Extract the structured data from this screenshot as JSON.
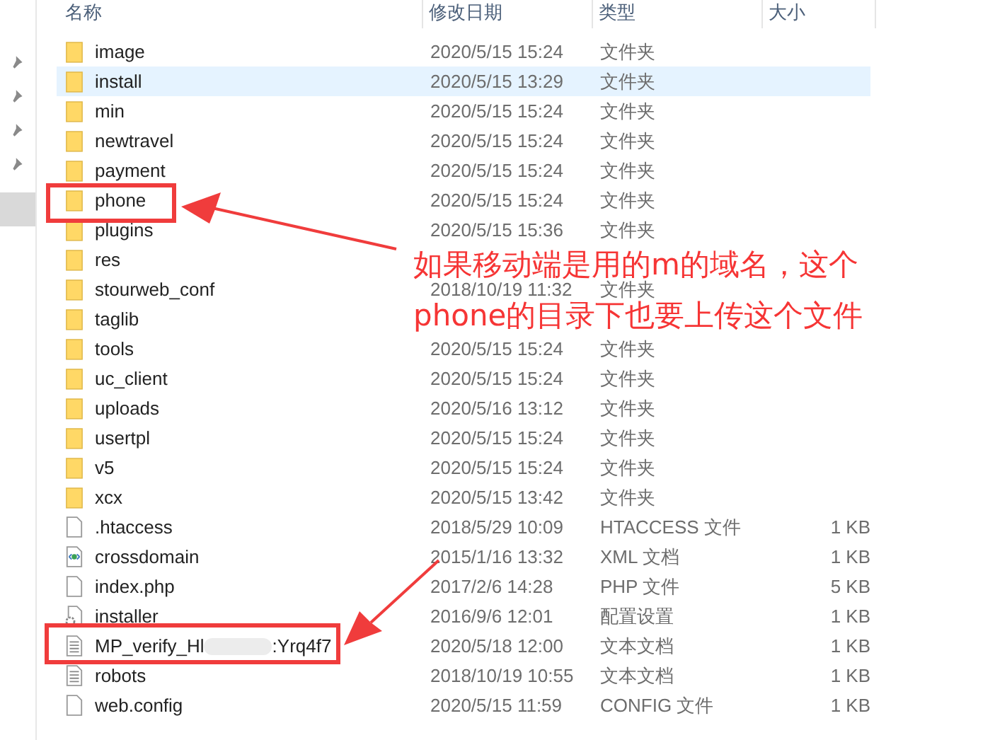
{
  "columns": [
    "名称",
    "修改日期",
    "类型",
    "大小"
  ],
  "rows": [
    {
      "kind": "folder",
      "name": "image",
      "date": "2020/5/15 15:24",
      "type": "文件夹",
      "hovered": false
    },
    {
      "kind": "folder",
      "name": "install",
      "date": "2020/5/15 13:29",
      "type": "文件夹",
      "hovered": true
    },
    {
      "kind": "folder",
      "name": "min",
      "date": "2020/5/15 15:24",
      "type": "文件夹",
      "hovered": false
    },
    {
      "kind": "folder",
      "name": "newtravel",
      "date": "2020/5/15 15:24",
      "type": "文件夹",
      "hovered": false
    },
    {
      "kind": "folder",
      "name": "payment",
      "date": "2020/5/15 15:24",
      "type": "文件夹",
      "hovered": false
    },
    {
      "kind": "folder",
      "name": "phone",
      "date": "2020/5/15 15:24",
      "type": "文件夹",
      "hovered": false
    },
    {
      "kind": "folder",
      "name": "plugins",
      "date": "2020/5/15 15:36",
      "type": "文件夹",
      "hovered": false
    },
    {
      "kind": "folder",
      "name": "res",
      "hovered": false
    },
    {
      "kind": "folder",
      "name": "stourweb_conf",
      "date": "2018/10/19 11:32",
      "type": "文件夹",
      "hovered": false
    },
    {
      "kind": "folder",
      "name": "taglib",
      "hovered": false
    },
    {
      "kind": "folder",
      "name": "tools",
      "date": "2020/5/15 15:24",
      "type": "文件夹",
      "hovered": false
    },
    {
      "kind": "folder",
      "name": "uc_client",
      "date": "2020/5/15 15:24",
      "type": "文件夹",
      "hovered": false
    },
    {
      "kind": "folder",
      "name": "uploads",
      "date": "2020/5/16 13:12",
      "type": "文件夹",
      "hovered": false
    },
    {
      "kind": "folder",
      "name": "usertpl",
      "date": "2020/5/15 15:24",
      "type": "文件夹",
      "hovered": false
    },
    {
      "kind": "folder",
      "name": "v5",
      "date": "2020/5/15 15:24",
      "type": "文件夹",
      "hovered": false
    },
    {
      "kind": "folder",
      "name": "xcx",
      "date": "2020/5/15 13:42",
      "type": "文件夹",
      "hovered": false
    },
    {
      "kind": "file",
      "name": ".htaccess",
      "date": "2018/5/29 10:09",
      "type": "HTACCESS 文件",
      "size": "1 KB",
      "hovered": false
    },
    {
      "kind": "xml",
      "name": "crossdomain",
      "date": "2015/1/16 13:32",
      "type": "XML 文档",
      "size": "1 KB",
      "hovered": false
    },
    {
      "kind": "file",
      "name": "index.php",
      "date": "2017/2/6 14:28",
      "type": "PHP 文件",
      "size": "5 KB",
      "hovered": false
    },
    {
      "kind": "settings",
      "name": "installer",
      "date": "2016/9/6 12:01",
      "type": "配置设置",
      "size": "1 KB",
      "hovered": false
    },
    {
      "kind": "text",
      "name": "MP_verify_Hl",
      "name_tail": ":Yrq4f7",
      "blurred": true,
      "date": "2020/5/18 12:00",
      "type": "文本文档",
      "size": "1 KB",
      "hovered": false
    },
    {
      "kind": "text",
      "name": "robots",
      "date": "2018/10/19 10:55",
      "type": "文本文档",
      "size": "1 KB",
      "hovered": false
    },
    {
      "kind": "file",
      "name": "web.config",
      "date": "2020/5/15 11:59",
      "type": "CONFIG 文件",
      "size": "1 KB",
      "hovered": false
    }
  ],
  "annotation": {
    "lines": [
      "如果移动端是用的m的域名，这个",
      "phone的目录下也要上传这个文件"
    ]
  }
}
